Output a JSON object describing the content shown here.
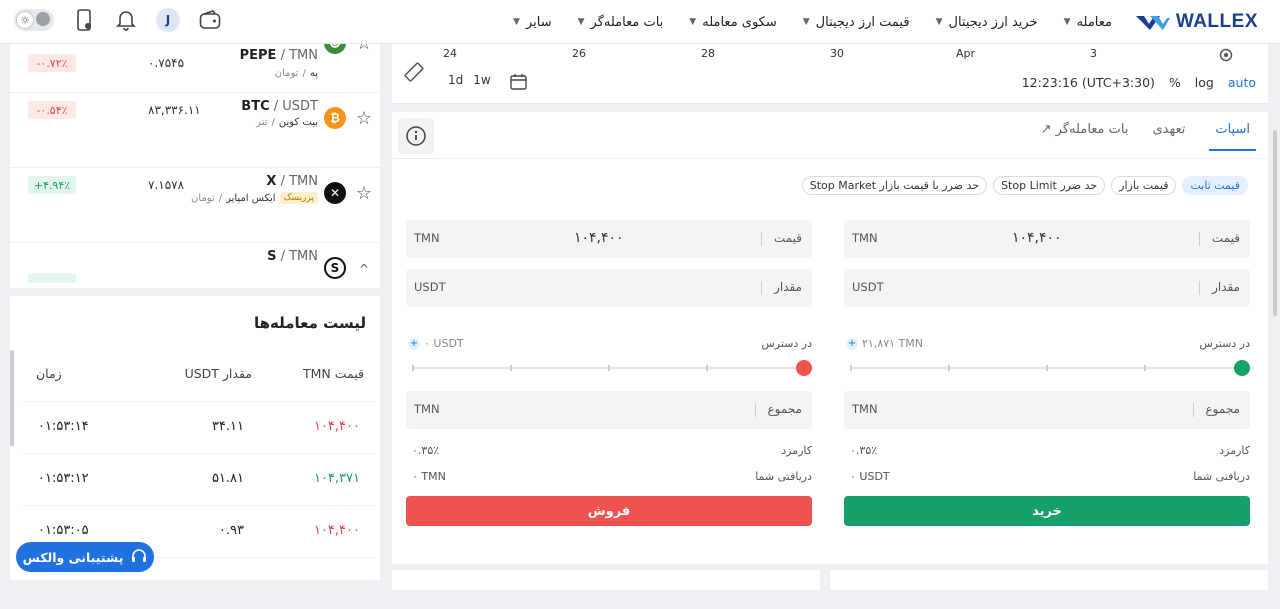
{
  "header": {
    "brand": "WALLEX",
    "nav": [
      "معامله",
      "خرید ارز دیجیتال",
      "قیمت ارز دیجیتال",
      "سکوی معامله",
      "بات معامله‌گر",
      "سایر"
    ],
    "avatar_letter": "J"
  },
  "markets": [
    {
      "base": "PEPE",
      "quote": "TMN",
      "quote_fa": "تومان",
      "name_fa": "په",
      "price": "۰.۷۵۴۵",
      "change": "-۰.۷۲٪",
      "dir": "neg",
      "tag": ""
    },
    {
      "base": "BTC",
      "quote": "USDT",
      "quote_fa": "تتر",
      "name_fa": "بیت کوین",
      "price": "۸۳,۳۳۶.۱۱",
      "change": "-۰.۵۴٪",
      "dir": "neg",
      "tag": ""
    },
    {
      "base": "X",
      "quote": "TMN",
      "quote_fa": "تومان",
      "name_fa": "ایکس امپایر",
      "price": "۷.۱۵۷۸",
      "change": "+۴.۹۴٪",
      "dir": "pos",
      "tag": "پرریسک"
    },
    {
      "base": "S",
      "quote": "TMN",
      "quote_fa": "",
      "name_fa": "",
      "price": "",
      "change": "",
      "dir": "pos",
      "tag": ""
    }
  ],
  "trades": {
    "title": "لیست معامله‌ها",
    "col_price": "قیمت TMN",
    "col_amount": "مقدار USDT",
    "col_time": "زمان",
    "rows": [
      {
        "price": "۱۰۴,۴۰۰",
        "amount": "۳۴.۱۱",
        "time": "۰۱:۵۳:۱۴",
        "dir": "neg"
      },
      {
        "price": "۱۰۴,۳۷۱",
        "amount": "۵۱.۸۱",
        "time": "۰۱:۵۳:۱۲",
        "dir": "pos"
      },
      {
        "price": "۱۰۴,۴۰۰",
        "amount": "۰.۹۳",
        "time": "۰۱:۵۳:۰۵",
        "dir": "neg"
      }
    ]
  },
  "support_label": "پشتیبانی والکس",
  "chart": {
    "x_labels": [
      "24",
      "26",
      "28",
      "30",
      "Apr",
      "3"
    ],
    "intervals": [
      "1d",
      "1w"
    ],
    "clock": "12:23:16 (UTC+3:30)",
    "pct": "%",
    "log": "log",
    "auto": "auto"
  },
  "order": {
    "tabs": [
      "اسپات",
      "تعهدی",
      "بات معامله‌گر"
    ],
    "types": [
      "قیمت ثابت",
      "قیمت بازار",
      "حد ضرر Stop Limit",
      "حد ضرر با قیمت بازار Stop Market"
    ],
    "price_label": "قیمت",
    "amount_label": "مقدار",
    "total_label": "مجموع",
    "avail_label": "در دسترس",
    "fee_label": "کارمزد",
    "receive_label": "دریافتی شما",
    "buy": {
      "price": "۱۰۴,۴۰۰",
      "price_unit": "TMN",
      "amount_unit": "USDT",
      "available": "۲۱,۸۷۱ TMN",
      "total_unit": "TMN",
      "fee": "۰.۳۵٪",
      "receive": "۰ USDT",
      "button": "خرید"
    },
    "sell": {
      "price": "۱۰۴,۴۰۰",
      "price_unit": "TMN",
      "amount_unit": "USDT",
      "available": "۰ USDT",
      "total_unit": "TMN",
      "fee": "۰.۳۵٪",
      "receive": "۰ TMN",
      "button": "فروش"
    }
  },
  "colors": {
    "brand": "#1a3f8f",
    "accent": "#1f72e0",
    "buy": "#16a06a",
    "sell": "#ef5350"
  }
}
